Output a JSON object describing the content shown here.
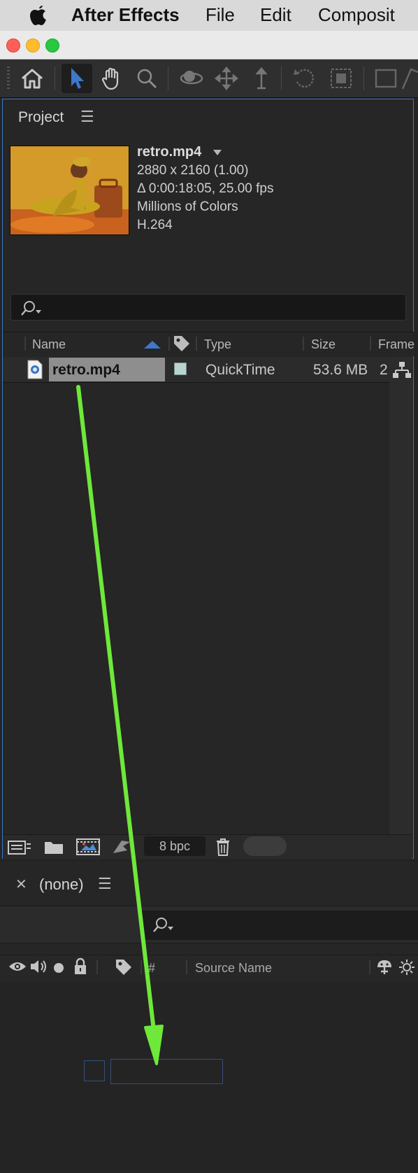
{
  "menubar": {
    "app_name": "After Effects",
    "items": [
      "File",
      "Edit",
      "Composit"
    ]
  },
  "toolbar": {
    "tools": [
      "home-icon",
      "selection-tool-icon",
      "hand-tool-icon",
      "zoom-tool-icon",
      "orbit-camera-icon",
      "pan-camera-icon",
      "dolly-camera-icon",
      "rotate-tool-icon",
      "pan-behind-icon",
      "rectangle-tool-icon",
      "pen-tool-icon"
    ],
    "active_tool": "selection-tool-icon",
    "accent": "#3d78c9"
  },
  "project_panel": {
    "title": "Project",
    "preview": {
      "name": "retro.mp4",
      "dimensions": "2880 x 2160 (1.00)",
      "duration": "Δ 0:00:18:05, 25.00 fps",
      "colors": "Millions of Colors",
      "codec": "H.264"
    },
    "search": {
      "placeholder": ""
    },
    "columns": {
      "name": "Name",
      "type": "Type",
      "size": "Size",
      "frame": "Frame"
    },
    "rows": [
      {
        "name": "retro.mp4",
        "label_color": "#b8d4cf",
        "type": "QuickTime",
        "size": "53.6 MB",
        "frame": "2"
      }
    ],
    "footer": {
      "bpc": "8 bpc"
    }
  },
  "timeline_panel": {
    "title": "(none)",
    "columns": {
      "number": "#",
      "source_name": "Source Name"
    }
  },
  "annotation": {
    "arrow_color": "#6ee83a"
  }
}
